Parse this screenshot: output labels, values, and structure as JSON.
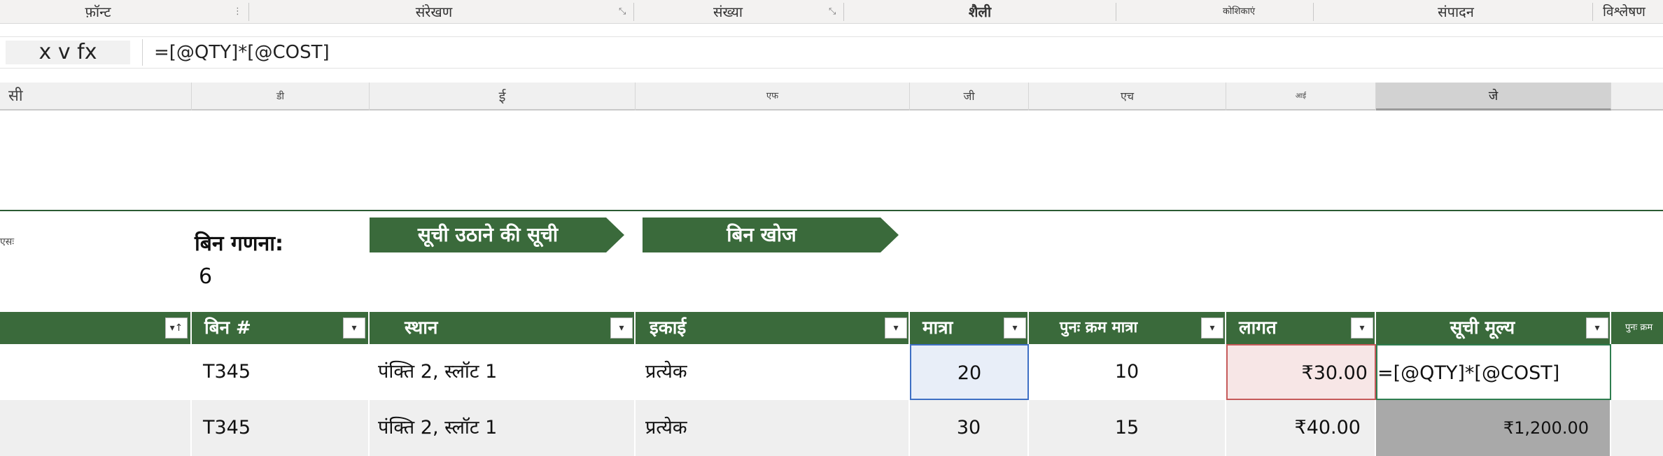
{
  "ribbon": {
    "groups": [
      "फ़ॉन्ट",
      "संरेखण",
      "संख्या",
      "शैली",
      "कोशिकाएं",
      "संपादन",
      "विश्लेषण"
    ]
  },
  "formula_bar": {
    "name_box": "x v fx",
    "formula": "=[@QTY]*[@COST]"
  },
  "columns": [
    "सी",
    "डी",
    "ई",
    "एफ",
    "जी",
    "एच",
    "आई",
    "जे"
  ],
  "sheet": {
    "left_tag": "एसः",
    "bin_count_label": "बिन गणना:",
    "bin_count_value": "6",
    "pick_list_button": "सूची उठाने की सूची",
    "bin_lookup_button": "बिन खोज"
  },
  "table": {
    "headers": [
      "बिन #",
      "स्थान",
      "इकाई",
      "मात्रा",
      "पुनः क्रम मात्रा",
      "लागत",
      "सूची मूल्य",
      "पुनः क्रम"
    ],
    "rows": [
      {
        "bin": "T345",
        "location": "पंक्ति 2, स्लॉट 1",
        "unit": "प्रत्येक",
        "qty": "20",
        "reorder_qty": "10",
        "cost": "₹30.00",
        "list_value": "=[@QTY]*[@COST]"
      },
      {
        "bin": "T345",
        "location": "पंक्ति 2, स्लॉट 1",
        "unit": "प्रत्येक",
        "qty": "30",
        "reorder_qty": "15",
        "cost": "₹40.00",
        "list_value": "₹1,200.00"
      }
    ]
  },
  "colors": {
    "header_green": "#3a6a3b",
    "qty_highlight": "#3e6fc4",
    "cost_highlight": "#c65a5a",
    "edit_border": "#2e7d4f"
  }
}
